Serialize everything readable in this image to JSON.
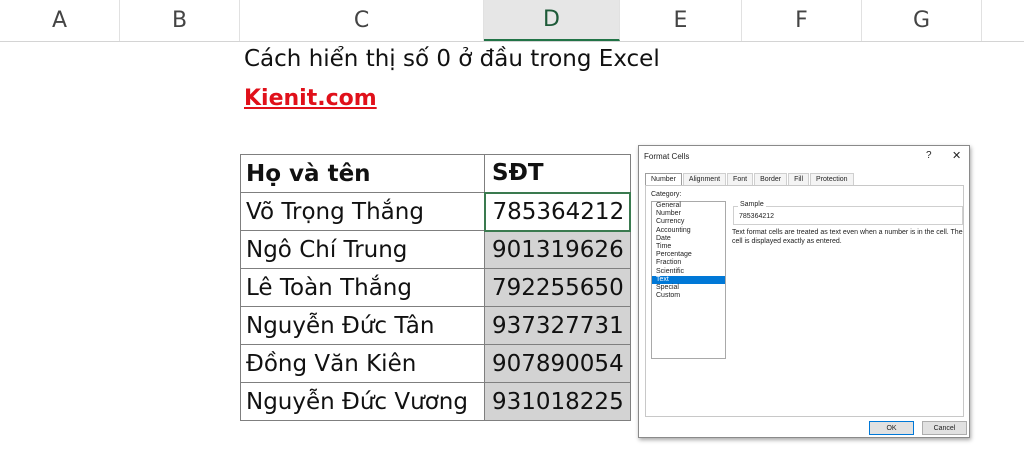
{
  "sheet": {
    "columns": [
      "A",
      "B",
      "C",
      "D",
      "E",
      "F",
      "G"
    ],
    "title": "Cách hiển thị số 0 ở đầu trong Excel",
    "link": "Kienit.com",
    "table": {
      "headers": [
        "Họ và tên",
        "SĐT"
      ],
      "rows": [
        [
          "Võ Trọng Thắng",
          "785364212"
        ],
        [
          "Ngô Chí Trung",
          "901319626"
        ],
        [
          "Lê Toàn Thắng",
          "792255650"
        ],
        [
          "Nguyễn Đức Tân",
          "937327731"
        ],
        [
          "Đồng Văn Kiên",
          "907890054"
        ],
        [
          "Nguyễn Đức Vương",
          "931018225"
        ]
      ]
    }
  },
  "dialog": {
    "title": "Format Cells",
    "help": "?",
    "close": "✕",
    "tabs": [
      "Number",
      "Alignment",
      "Font",
      "Border",
      "Fill",
      "Protection"
    ],
    "category_label": "Category:",
    "categories": [
      "General",
      "Number",
      "Currency",
      "Accounting",
      "Date",
      "Time",
      "Percentage",
      "Fraction",
      "Scientific",
      "Text",
      "Special",
      "Custom"
    ],
    "selected_category": "Text",
    "sample_label": "Sample",
    "sample_value": "785364212",
    "description": "Text format cells are treated as text even when a number is in the cell. The cell is displayed exactly as entered.",
    "ok": "OK",
    "cancel": "Cancel"
  }
}
